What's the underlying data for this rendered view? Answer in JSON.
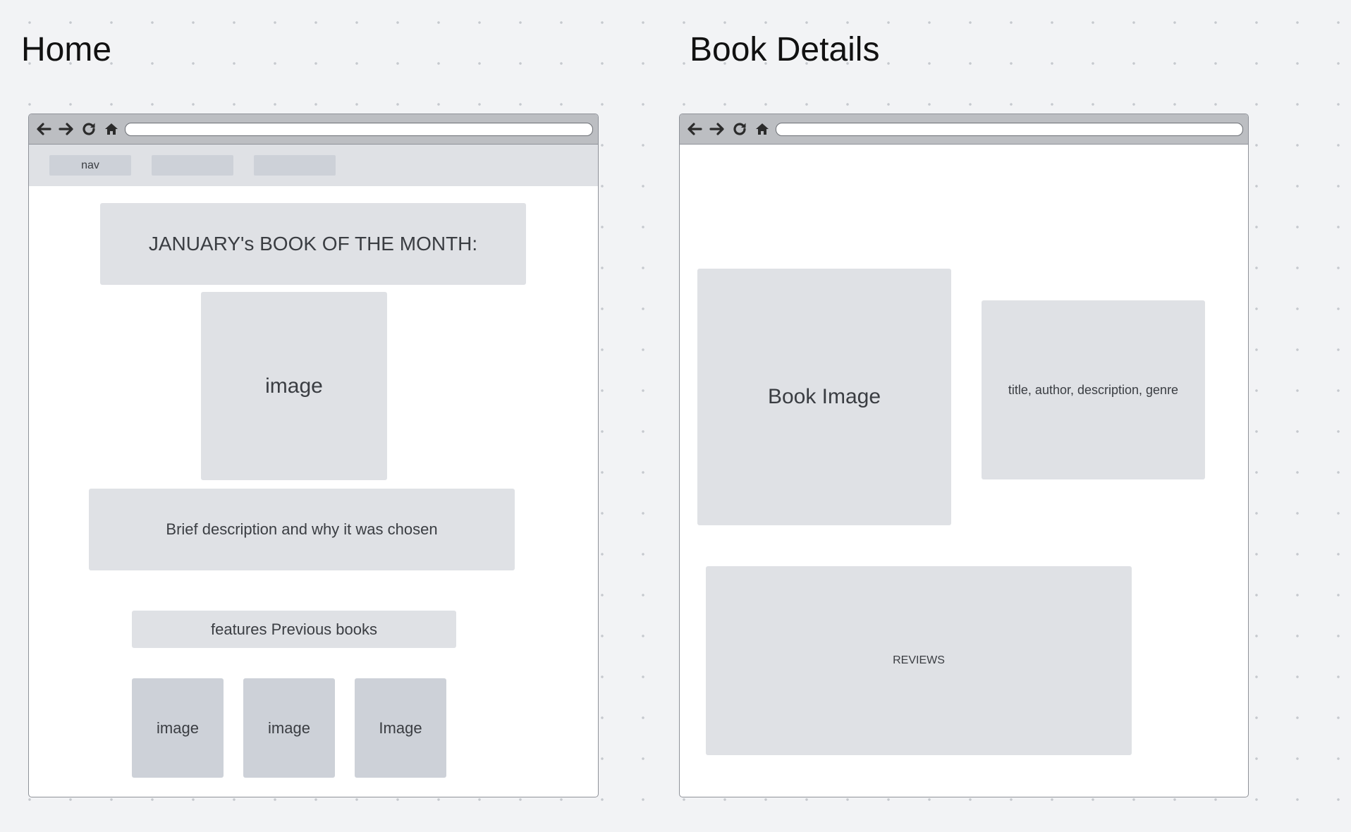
{
  "frames": {
    "home": {
      "title": "Home",
      "nav": [
        "nav",
        "",
        ""
      ],
      "book_of_month_heading": "JANUARY's BOOK OF THE MONTH:",
      "featured_image": "image",
      "description": "Brief description and why it was chosen",
      "previous_heading": "features Previous books",
      "previous_images": [
        "image",
        "image",
        "Image"
      ]
    },
    "book_details": {
      "title": "Book Details",
      "book_image": "Book Image",
      "book_info": "title, author, description, genre",
      "reviews": "REVIEWS"
    }
  },
  "browser_icons": [
    "back-arrow-icon",
    "forward-arrow-icon",
    "reload-icon",
    "home-icon"
  ],
  "colors": {
    "canvas": "#f2f3f5",
    "placeholder": "#dfe1e5",
    "placeholder_dark": "#cdd1d8",
    "browser_bar": "#bcbec2",
    "title_text": "#111111"
  }
}
